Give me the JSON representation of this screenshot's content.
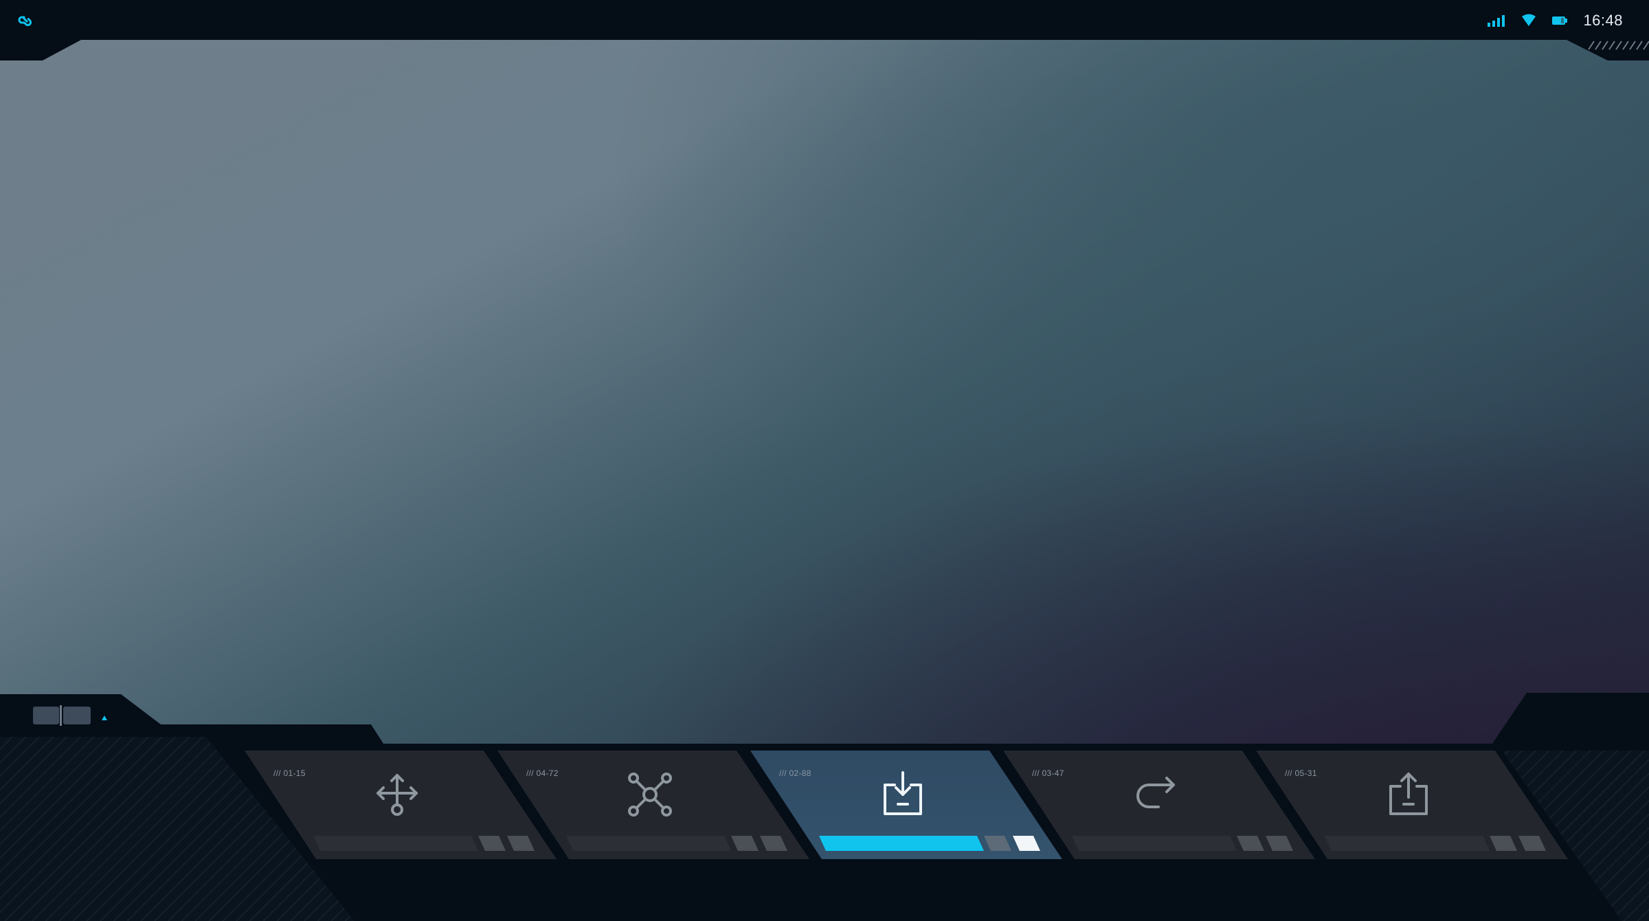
{
  "status_bar": {
    "app_icon": "link-icon",
    "signal_icon": "cellular-signal-icon",
    "wifi_icon": "wifi-icon",
    "battery_icon": "battery-icon",
    "time": "16:48"
  },
  "colors": {
    "accent": "#10c4ee",
    "panel": "#23272d",
    "active_panel_top": "#2f4a63",
    "active_panel_bottom": "#34536d",
    "bottom_bar": "#050d17"
  },
  "dock_toggle": {
    "icon": "split-view-icon",
    "arrow_icon": "triangle-up-icon"
  },
  "tiles": [
    {
      "code": "/// 01-15",
      "icon": "move-arrows-icon",
      "active": false,
      "progress": 0
    },
    {
      "code": "/// 04-72",
      "icon": "network-nodes-icon",
      "active": false,
      "progress": 0
    },
    {
      "code": "/// 02-88",
      "icon": "download-tray-icon",
      "active": true,
      "progress": 1
    },
    {
      "code": "/// 03-47",
      "icon": "redirect-arrow-icon",
      "active": false,
      "progress": 0
    },
    {
      "code": "/// 05-31",
      "icon": "upload-tray-icon",
      "active": false,
      "progress": 0
    }
  ]
}
